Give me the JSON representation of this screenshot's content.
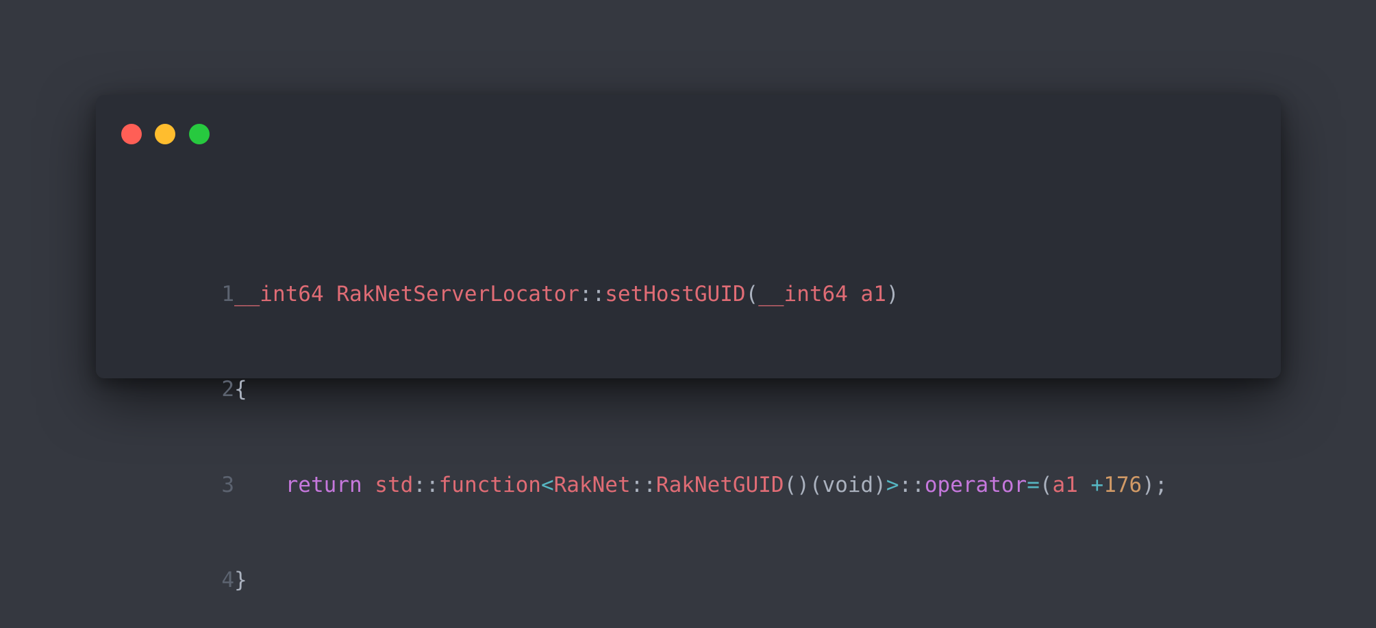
{
  "window": {
    "buttons": [
      {
        "name": "close",
        "color": "#ff5f56"
      },
      {
        "name": "minimize",
        "color": "#ffbd2e"
      },
      {
        "name": "maximize",
        "color": "#27c93f"
      }
    ]
  },
  "colors": {
    "default": "#abb2bf",
    "red": "#e06c75",
    "purple": "#c678dd",
    "cyan": "#56b6c2",
    "orange": "#d19a66",
    "line_number": "#5c6370"
  },
  "code": {
    "lines": [
      {
        "number": "1",
        "tokens": [
          {
            "text": "__int64 RakNetServerLocator",
            "color": "red"
          },
          {
            "text": "::",
            "color": "default"
          },
          {
            "text": "setHostGUID",
            "color": "red"
          },
          {
            "text": "(",
            "color": "default"
          },
          {
            "text": "__int64 a1",
            "color": "red"
          },
          {
            "text": ")",
            "color": "default"
          }
        ]
      },
      {
        "number": "2",
        "tokens": [
          {
            "text": "{",
            "color": "default"
          }
        ]
      },
      {
        "number": "3",
        "tokens": [
          {
            "text": "    ",
            "color": "default"
          },
          {
            "text": "return",
            "color": "purple"
          },
          {
            "text": " ",
            "color": "default"
          },
          {
            "text": "std",
            "color": "red"
          },
          {
            "text": "::",
            "color": "default"
          },
          {
            "text": "function",
            "color": "red"
          },
          {
            "text": "<",
            "color": "cyan"
          },
          {
            "text": "RakNet",
            "color": "red"
          },
          {
            "text": "::",
            "color": "default"
          },
          {
            "text": "RakNetGUID",
            "color": "red"
          },
          {
            "text": "()(void)",
            "color": "default"
          },
          {
            "text": ">",
            "color": "cyan"
          },
          {
            "text": "::",
            "color": "default"
          },
          {
            "text": "operator",
            "color": "purple"
          },
          {
            "text": "=",
            "color": "cyan"
          },
          {
            "text": "(",
            "color": "default"
          },
          {
            "text": "a1 ",
            "color": "red"
          },
          {
            "text": "+",
            "color": "cyan"
          },
          {
            "text": "176",
            "color": "orange"
          },
          {
            "text": ");",
            "color": "default"
          }
        ]
      },
      {
        "number": "4",
        "tokens": [
          {
            "text": "}",
            "color": "default"
          }
        ]
      }
    ]
  }
}
